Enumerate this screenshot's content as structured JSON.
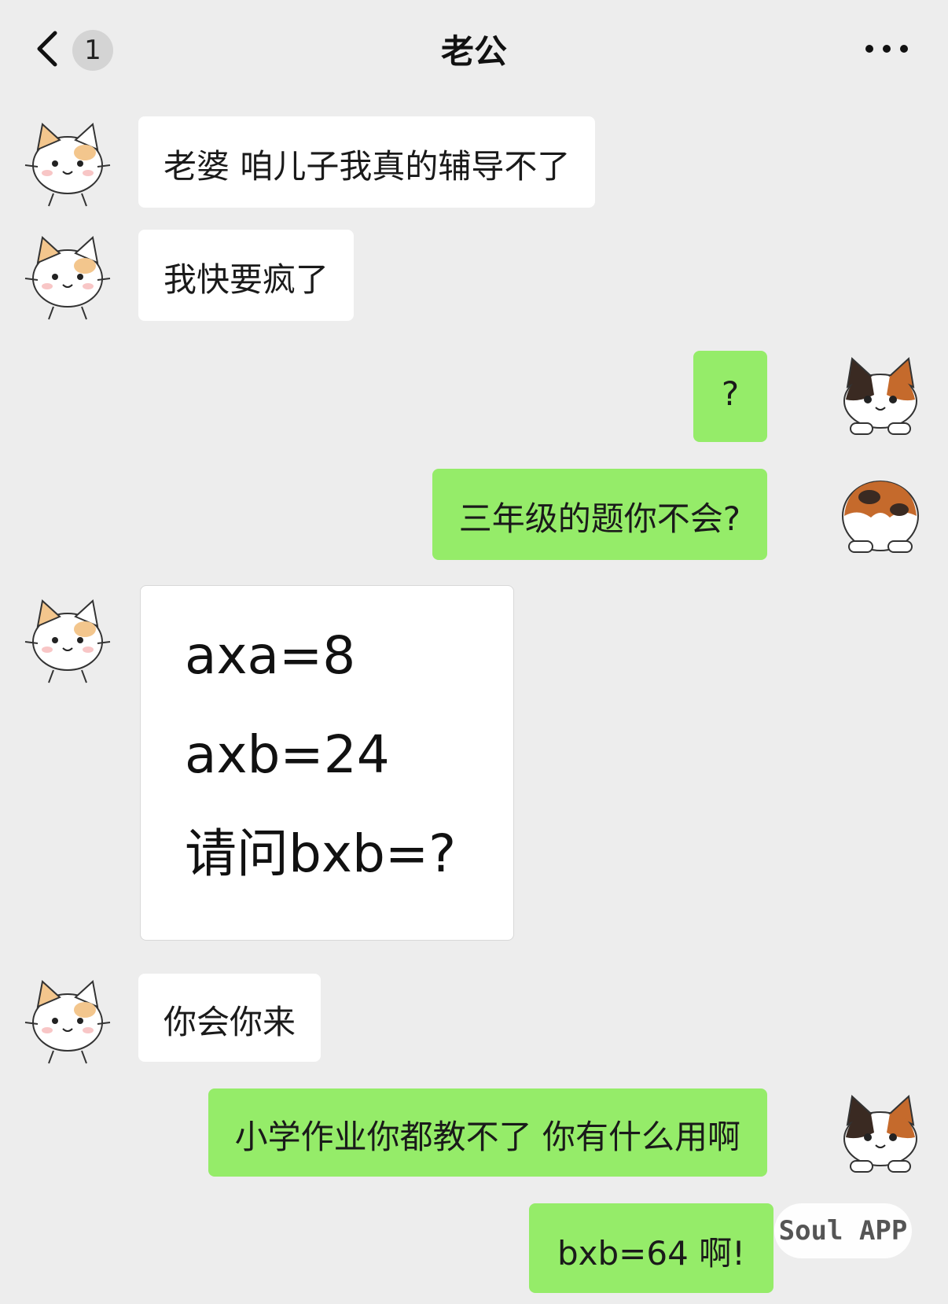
{
  "header": {
    "unread_count": "1",
    "title": "老公"
  },
  "messages": [
    {
      "side": "left",
      "text": "老婆 咱儿子我真的辅导不了"
    },
    {
      "side": "left",
      "text": "我快要疯了"
    },
    {
      "side": "right",
      "text": "?"
    },
    {
      "side": "right",
      "text": "三年级的题你不会?"
    },
    {
      "side": "left",
      "lines": [
        "axa=8",
        "axb=24",
        "请问bxb=?"
      ]
    },
    {
      "side": "left",
      "text": "你会你来"
    },
    {
      "side": "right",
      "text": "小学作业你都教不了 你有什么用啊"
    },
    {
      "side": "right",
      "text": "bxb=64 啊!"
    }
  ],
  "watermark": "Soul APP",
  "colors": {
    "background": "#ededed",
    "received_bubble": "#ffffff",
    "sent_bubble": "#95ec69"
  },
  "icons": {
    "back": "chevron-left-icon",
    "more": "more-dots-icon",
    "left_avatar": "white-kitten-avatar",
    "right_avatar": "calico-cat-avatar"
  }
}
